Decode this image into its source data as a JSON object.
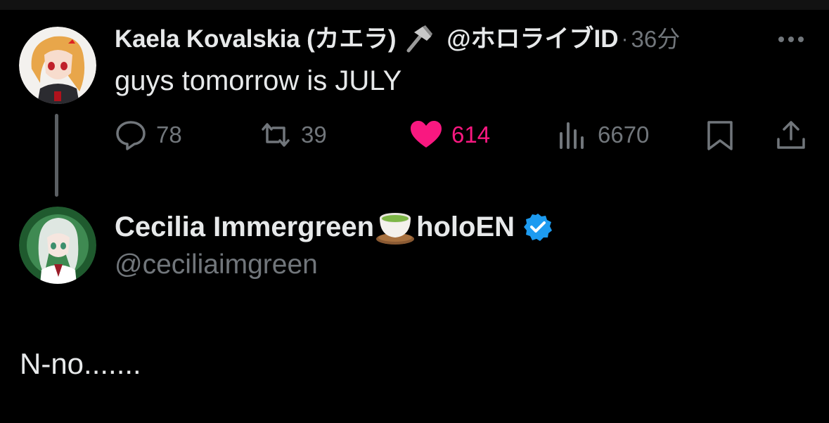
{
  "tweet": {
    "author_name": "Kaela Kovalskia (カエラ)",
    "author_emoji": "hammer-icon",
    "author_handle": "@ホロライブID",
    "separator": "·",
    "time": "36分",
    "text": "guys tomorrow is JULY",
    "stats": {
      "replies": "78",
      "retweets": "39",
      "likes": "614",
      "views": "6670"
    }
  },
  "reply": {
    "author_name_part1": "Cecilia Immergreen",
    "author_emoji": "tea-icon",
    "author_name_part2": "holoEN",
    "verified": true,
    "author_handle": "@ceciliaimgreen",
    "text": "N-no......."
  },
  "colors": {
    "background": "#000000",
    "primary_text": "#e7e9ea",
    "secondary_text": "#71767b",
    "like": "#f91880",
    "verified": "#1d9bf0"
  }
}
